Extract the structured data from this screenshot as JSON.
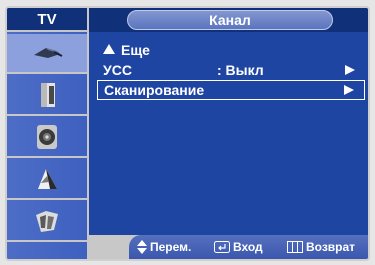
{
  "sidebar": {
    "title": "TV",
    "items": [
      {
        "icon": "antenna-icon"
      },
      {
        "icon": "picture-icon"
      },
      {
        "icon": "sound-icon"
      },
      {
        "icon": "channel-icon"
      },
      {
        "icon": "setup-icon"
      }
    ]
  },
  "header": {
    "title": "Канал"
  },
  "menu": {
    "more_label": "Еще",
    "rows": [
      {
        "label": "УСС",
        "value": ": Выкл"
      },
      {
        "label": "Сканирование",
        "value": ""
      }
    ]
  },
  "footer": {
    "move": "Перем.",
    "enter": "Вход",
    "return": "Возврат"
  }
}
